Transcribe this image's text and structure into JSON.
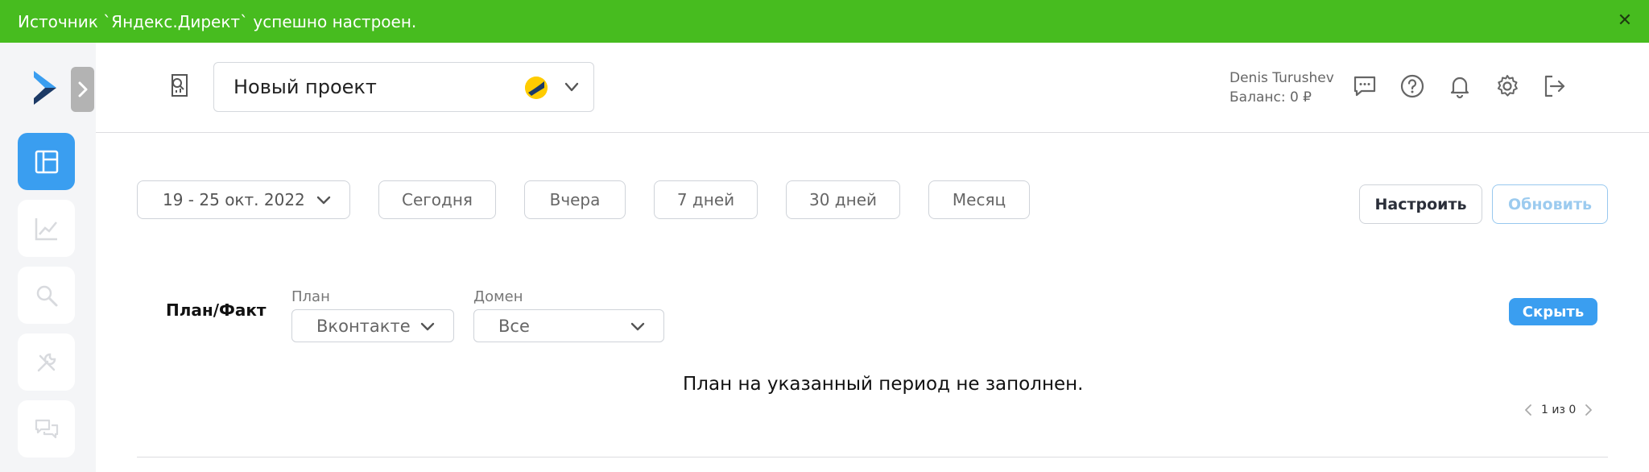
{
  "notification": {
    "text": "Источник `Яндекс.Директ` успешно настроен.",
    "close_icon": "close-icon"
  },
  "sidebar": {
    "items": [
      {
        "icon": "dashboard-icon",
        "active": true
      },
      {
        "icon": "chart-icon",
        "active": false
      },
      {
        "icon": "search-icon",
        "active": false
      },
      {
        "icon": "tools-icon",
        "active": false
      },
      {
        "icon": "chat-icon",
        "active": false
      }
    ]
  },
  "header": {
    "project_name": "Новый проект",
    "user_name": "Denis Turushev",
    "balance": "Баланс: 0 ₽",
    "icons": [
      "messages-icon",
      "help-icon",
      "bell-icon",
      "gear-icon",
      "logout-icon"
    ]
  },
  "filters": {
    "date_range": "19 - 25 окт. 2022",
    "periods": [
      "Сегодня",
      "Вчера",
      "7 дней",
      "30 дней",
      "Месяц"
    ],
    "configure_label": "Настроить",
    "refresh_label": "Обновить"
  },
  "widget": {
    "title": "План/Факт",
    "plan_label": "План",
    "plan_value": "Вконтакте",
    "domain_label": "Домен",
    "domain_value": "Все",
    "hide_label": "Скрыть",
    "empty_message": "План на указанный период не заполнен.",
    "pager_text": "1 из 0"
  },
  "colors": {
    "notice_green": "#47bc1f",
    "accent_blue": "#3a9ef0",
    "sidebar_bg": "#f4f5f7"
  }
}
